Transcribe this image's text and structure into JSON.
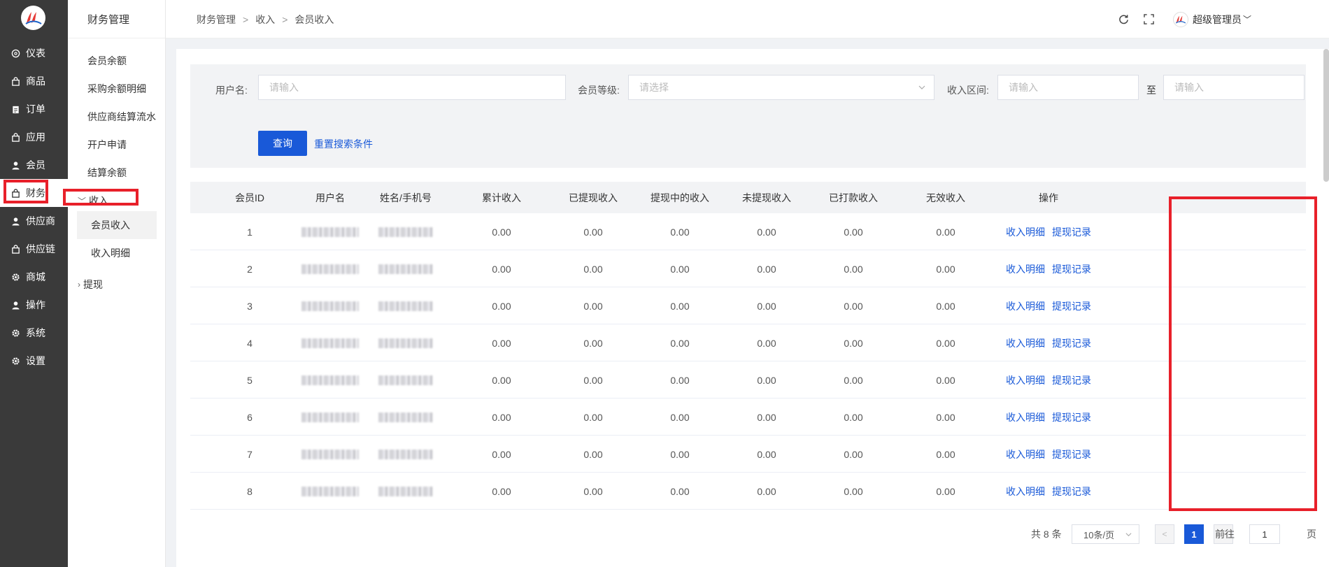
{
  "nav": {
    "items": [
      {
        "label": "仪表",
        "icon": "dashboard-icon"
      },
      {
        "label": "商品",
        "icon": "bag-icon"
      },
      {
        "label": "订单",
        "icon": "clipboard-icon"
      },
      {
        "label": "应用",
        "icon": "bag-icon"
      },
      {
        "label": "会员",
        "icon": "user-icon"
      },
      {
        "label": "财务",
        "icon": "bag-icon"
      },
      {
        "label": "供应商",
        "icon": "user-icon"
      },
      {
        "label": "供应链",
        "icon": "bag-icon"
      },
      {
        "label": "商城",
        "icon": "gear-icon"
      },
      {
        "label": "操作",
        "icon": "user-icon"
      },
      {
        "label": "系统",
        "icon": "gear-icon"
      },
      {
        "label": "设置",
        "icon": "gear-icon"
      }
    ],
    "active": "财务"
  },
  "subnav": {
    "title": "财务管理",
    "items": [
      "会员余额",
      "采购余额明细",
      "供应商结算流水",
      "开户申请",
      "结算余额"
    ],
    "group_income": "收入",
    "income_children": [
      "会员收入",
      "收入明细"
    ],
    "group_withdraw": "提现"
  },
  "breadcrumb": [
    "财务管理",
    "收入",
    "会员收入"
  ],
  "user": {
    "name": "超级管理员"
  },
  "filter": {
    "username_label": "用户名:",
    "username_placeholder": "请输入",
    "level_label": "会员等级:",
    "level_placeholder": "请选择",
    "range_label": "收入区间:",
    "range_from_placeholder": "请输入",
    "range_sep": "至",
    "range_to_placeholder": "请输入",
    "query_button": "查询",
    "reset_button": "重置搜索条件"
  },
  "table": {
    "columns": [
      "会员ID",
      "用户名",
      "姓名/手机号",
      "累计收入",
      "已提现收入",
      "提现中的收入",
      "未提现收入",
      "已打款收入",
      "无效收入",
      "操作"
    ],
    "rows": [
      {
        "id": "1",
        "total": "0.00",
        "withdrawn": "0.00",
        "withdrawing": "0.00",
        "not_withdrawn": "0.00",
        "paid": "0.00",
        "invalid": "0.00"
      },
      {
        "id": "2",
        "total": "0.00",
        "withdrawn": "0.00",
        "withdrawing": "0.00",
        "not_withdrawn": "0.00",
        "paid": "0.00",
        "invalid": "0.00"
      },
      {
        "id": "3",
        "total": "0.00",
        "withdrawn": "0.00",
        "withdrawing": "0.00",
        "not_withdrawn": "0.00",
        "paid": "0.00",
        "invalid": "0.00"
      },
      {
        "id": "4",
        "total": "0.00",
        "withdrawn": "0.00",
        "withdrawing": "0.00",
        "not_withdrawn": "0.00",
        "paid": "0.00",
        "invalid": "0.00"
      },
      {
        "id": "5",
        "total": "0.00",
        "withdrawn": "0.00",
        "withdrawing": "0.00",
        "not_withdrawn": "0.00",
        "paid": "0.00",
        "invalid": "0.00"
      },
      {
        "id": "6",
        "total": "0.00",
        "withdrawn": "0.00",
        "withdrawing": "0.00",
        "not_withdrawn": "0.00",
        "paid": "0.00",
        "invalid": "0.00"
      },
      {
        "id": "7",
        "total": "0.00",
        "withdrawn": "0.00",
        "withdrawing": "0.00",
        "not_withdrawn": "0.00",
        "paid": "0.00",
        "invalid": "0.00"
      },
      {
        "id": "8",
        "total": "0.00",
        "withdrawn": "0.00",
        "withdrawing": "0.00",
        "not_withdrawn": "0.00",
        "paid": "0.00",
        "invalid": "0.00"
      }
    ],
    "action_detail": "收入明细",
    "action_withdraw": "提现记录"
  },
  "pagination": {
    "total_text": "共 8 条",
    "page_size": "10条/页",
    "current_page": "1",
    "goto_label": "前往",
    "goto_value": "1",
    "page_suffix": "页"
  },
  "colors": {
    "accent": "#1959d8",
    "highlight": "#e8202a",
    "nav_bg": "#3a3a3a"
  }
}
